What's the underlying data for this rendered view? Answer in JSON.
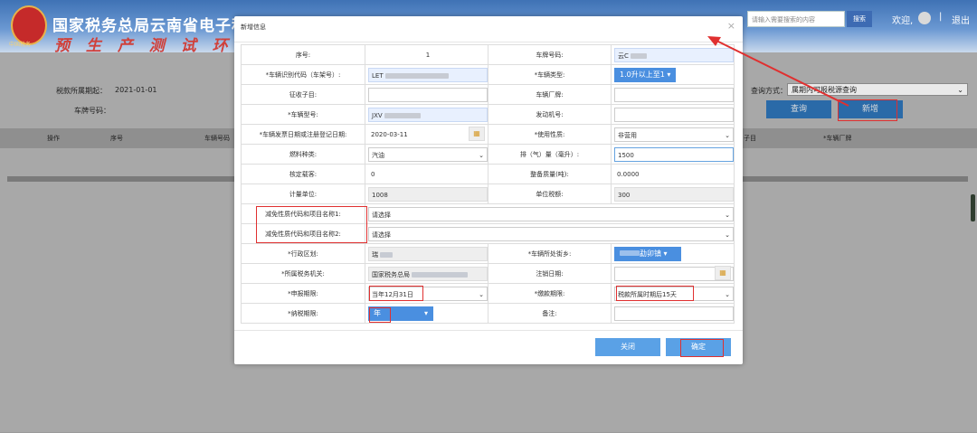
{
  "header": {
    "title": "国家税务总局云南省电子税",
    "watermark": "预 生 产 测 试 环",
    "emblem_text": "中国税务",
    "search_placeholder": "请输入需要搜索的内容",
    "search_button": "搜索",
    "welcome": "欢迎,",
    "separator": "|",
    "logout": "退出"
  },
  "query_panel": {
    "period_label": "税款所属期起：",
    "period_value": "2021-01-01",
    "plate_label": "车牌号码：",
    "method_label": "查询方式：",
    "method_value": "属期内可报税源查询",
    "query_button": "查询",
    "add_button": "新增"
  },
  "table_header": {
    "columns": [
      "操作",
      "序号",
      "车辆号码",
      "子目",
      "*车辆厂牌"
    ]
  },
  "modal": {
    "title": "新增信息",
    "close": "×",
    "fields": {
      "seq_label": "序号:",
      "seq_value": "1",
      "plate_label": "车牌号码:",
      "plate_value": "云C",
      "vin_label": "*车辆识别代码（车架号）:",
      "vin_value": "LET",
      "vtype_label": "*车辆类型:",
      "vtype_value": "1.0升以上至1",
      "collect_label": "征收子目:",
      "brand_label": "车辆厂牌:",
      "model_label": "*车辆型号:",
      "model_value": "JXV",
      "engine_label": "发动机号:",
      "invoice_label": "*车辆发票日期或注册登记日期:",
      "invoice_value": "2020-03-11",
      "usage_label": "*使用性质:",
      "usage_value": "非营用",
      "fuel_label": "燃料种类:",
      "fuel_value": "汽油",
      "displacement_label": "排（气）量（毫升）:",
      "displacement_value": "1500",
      "capacity_label": "核定载客:",
      "capacity_value": "0",
      "mass_label": "整备质量(吨):",
      "mass_value": "0.0000",
      "unit_label": "计量单位:",
      "unit_value": "1008",
      "unit_tax_label": "单位税额:",
      "unit_tax_value": "300",
      "relief1_label": "减免性质代码和项目名称1:",
      "relief1_value": "请选择",
      "relief2_label": "减免性质代码和项目名称2:",
      "relief2_value": "请选择",
      "region_label": "*行政区划:",
      "region_value": "瑞",
      "street_label": "*车辆所处街乡:",
      "street_value": "勐卯镇",
      "taxorg_label": "*所属税务机关:",
      "taxorg_value": "国家税务总局",
      "cancel_label": "注销日期:",
      "declare_label": "*申报期限:",
      "declare_value": "当年12月31日",
      "payment_label": "*缴款期限:",
      "payment_value": "税款所属时期后15天",
      "term_label": "*纳税期限:",
      "term_value": "年",
      "remark_label": "备注:"
    },
    "close_button": "关闭",
    "confirm_button": "确定"
  },
  "colors": {
    "annotation_red": "#e03030",
    "accent_blue": "#5aa1e6"
  }
}
